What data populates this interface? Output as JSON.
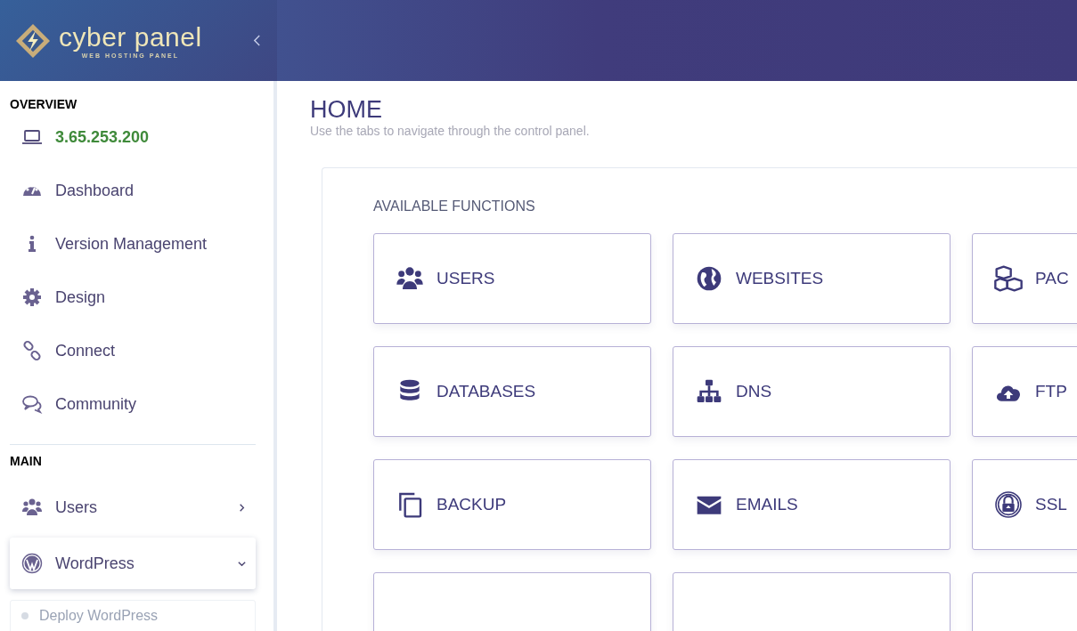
{
  "logo": {
    "name": "cyber panel",
    "tagline": "WEB HOSTING PANEL"
  },
  "sidebar": {
    "sections": [
      {
        "title": "OVERVIEW",
        "items": [
          {
            "label": "3.65.253.200",
            "kind": "ip"
          },
          {
            "label": "Dashboard",
            "kind": "link"
          },
          {
            "label": "Version Management",
            "kind": "link"
          },
          {
            "label": "Design",
            "kind": "link"
          },
          {
            "label": "Connect",
            "kind": "link"
          },
          {
            "label": "Community",
            "kind": "link"
          }
        ]
      },
      {
        "title": "MAIN",
        "items": [
          {
            "label": "Users",
            "kind": "menu",
            "expanded": false
          },
          {
            "label": "WordPress",
            "kind": "menu",
            "expanded": true,
            "children": [
              {
                "label": "Deploy WordPress"
              }
            ]
          }
        ]
      }
    ]
  },
  "page": {
    "title": "HOME",
    "subtitle": "Use the tabs to navigate through the control panel."
  },
  "functions": {
    "title": "AVAILABLE FUNCTIONS",
    "tiles": [
      {
        "label": "USERS"
      },
      {
        "label": "WEBSITES"
      },
      {
        "label": "PAC"
      },
      {
        "label": "DATABASES"
      },
      {
        "label": "DNS"
      },
      {
        "label": "FTP"
      },
      {
        "label": "BACKUP"
      },
      {
        "label": "EMAILS"
      },
      {
        "label": "SSL"
      }
    ]
  }
}
